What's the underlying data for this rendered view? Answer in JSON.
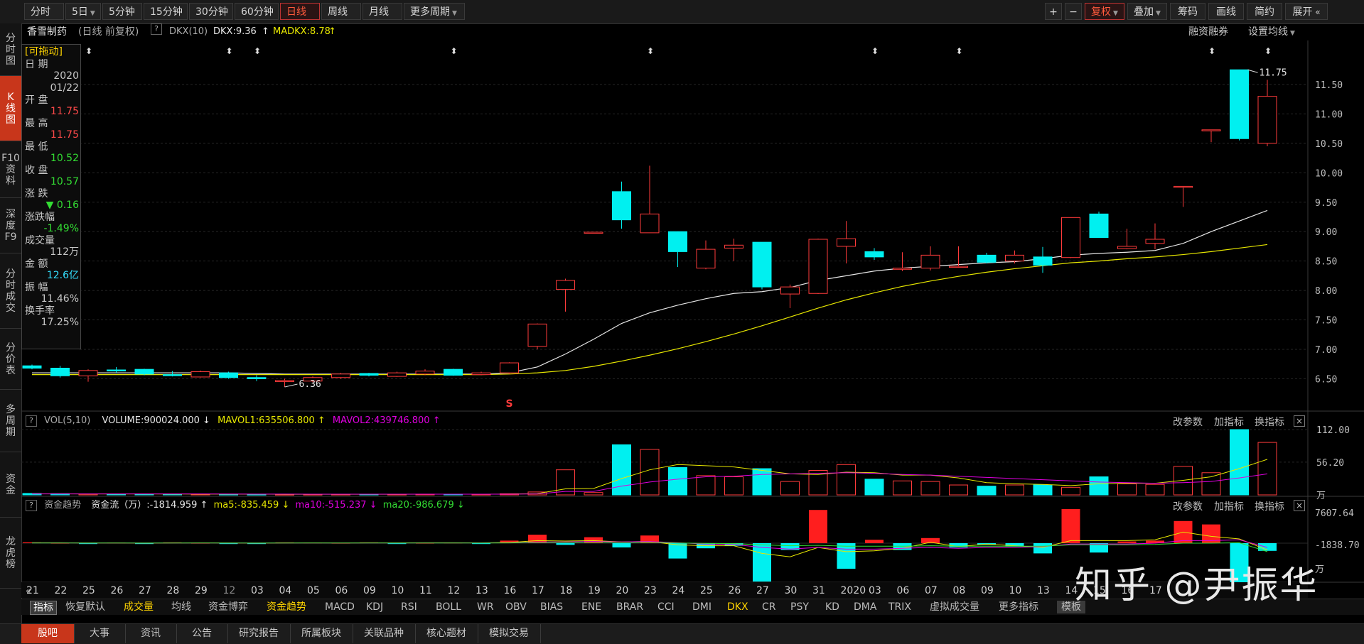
{
  "toolbar": {
    "left": [
      {
        "label": "分时",
        "dropdown": false,
        "active": false
      },
      {
        "label": "5日",
        "dropdown": true,
        "active": false
      },
      {
        "label": "5分钟",
        "dropdown": false,
        "active": false
      },
      {
        "label": "15分钟",
        "dropdown": false,
        "active": false
      },
      {
        "label": "30分钟",
        "dropdown": false,
        "active": false
      },
      {
        "label": "60分钟",
        "dropdown": false,
        "active": false
      },
      {
        "label": "日线",
        "dropdown": false,
        "active": true
      },
      {
        "label": "周线",
        "dropdown": false,
        "active": false
      },
      {
        "label": "月线",
        "dropdown": false,
        "active": false
      },
      {
        "label": "更多周期",
        "dropdown": true,
        "active": false
      }
    ],
    "right": [
      {
        "label": "+",
        "dropdown": false,
        "active": false
      },
      {
        "label": "−",
        "dropdown": false,
        "active": false
      },
      {
        "label": "复权",
        "dropdown": true,
        "active": true
      },
      {
        "label": "叠加",
        "dropdown": true,
        "active": false
      },
      {
        "label": "筹码",
        "dropdown": false,
        "active": false
      },
      {
        "label": "画线",
        "dropdown": false,
        "active": false
      },
      {
        "label": "简约",
        "dropdown": false,
        "active": false
      },
      {
        "label": "展开",
        "dropdown": false,
        "active": false
      }
    ]
  },
  "sidebar": [
    {
      "label": "分\n时\n图",
      "active": false
    },
    {
      "label": "K\n线\n图",
      "active": true
    },
    {
      "label": "F10\n资\n料",
      "active": false
    },
    {
      "label": "深\n度\nF9",
      "active": false
    },
    {
      "label": "分\n时\n成\n交",
      "active": false
    },
    {
      "label": "分\n价\n表",
      "active": false
    },
    {
      "label": "多\n周\n期",
      "active": false
    },
    {
      "label": "资\n金",
      "active": false
    },
    {
      "label": "龙\n虎\n榜",
      "active": false
    }
  ],
  "infobar": {
    "stock_name": "香雪制药",
    "period": "(日线 前复权)",
    "indicator": "DKX(10)",
    "dkx_label": "DKX:9.36",
    "madkx_label": "MADKX:8.78",
    "margin_link": "融资融券",
    "ma_settings": "设置均线"
  },
  "datebox": {
    "tag": "[可拖动]",
    "rows": [
      {
        "label": "日  期",
        "value": "2020",
        "color": "#c8c8c8"
      },
      {
        "label": "",
        "value": "01/22",
        "color": "#c8c8c8"
      },
      {
        "label": "开  盘",
        "value": "11.75",
        "color": "#ff4a4a"
      },
      {
        "label": "最  高",
        "value": "11.75",
        "color": "#ff4a4a"
      },
      {
        "label": "最  低",
        "value": "10.52",
        "color": "#33dd33"
      },
      {
        "label": "收  盘",
        "value": "10.57",
        "color": "#33dd33"
      },
      {
        "label": "涨  跌",
        "value": "▼ 0.16",
        "color": "#33dd33"
      },
      {
        "label": "涨跌幅",
        "value": "-1.49%",
        "color": "#33dd33"
      },
      {
        "label": "成交量",
        "value": "112万",
        "color": "#c8c8c8"
      },
      {
        "label": "金  额",
        "value": "12.6亿",
        "color": "#33e0ff"
      },
      {
        "label": "振  幅",
        "value": "11.46%",
        "color": "#c8c8c8"
      },
      {
        "label": "换手率",
        "value": "17.25%",
        "color": "#c8c8c8"
      }
    ]
  },
  "price_axis": [
    "11.50",
    "11.00",
    "10.50",
    "10.00",
    "9.50",
    "9.00",
    "8.50",
    "8.00",
    "7.50",
    "7.00",
    "6.50"
  ],
  "vol_axis": [
    "112.00",
    "56.20",
    "万"
  ],
  "fund_axis": [
    "7607.64",
    "-1838.70",
    "万"
  ],
  "vol_header": {
    "title": "VOL(5,10)",
    "volume": "VOLUME:900024.000",
    "mavol1": "MAVOL1:635506.800",
    "mavol2": "MAVOL2:439746.800"
  },
  "fund_header": {
    "title": "资金趋势",
    "flow": "资金流（万）:-1814.959",
    "ma5": "ma5:-835.459",
    "ma10": "ma10:-515.237",
    "ma20": "ma20:-986.679"
  },
  "panel_links": {
    "params": "改参数",
    "add": "加指标",
    "switch": "换指标",
    "close": "×"
  },
  "annotations": {
    "high_label": "11.75",
    "low_label": "6.36",
    "s_marker": "S"
  },
  "dates": [
    "21",
    "22",
    "25",
    "26",
    "27",
    "28",
    "29",
    "12",
    "03",
    "04",
    "05",
    "06",
    "09",
    "10",
    "11",
    "12",
    "13",
    "16",
    "17",
    "18",
    "19",
    "20",
    "23",
    "24",
    "25",
    "26",
    "27",
    "30",
    "31",
    "2020",
    "03",
    "06",
    "07",
    "08",
    "09",
    "10",
    "13",
    "14",
    "15",
    "16",
    "17"
  ],
  "indicator_tabs": [
    {
      "label": "指标",
      "active": true
    },
    {
      "label": "恢复默认",
      "active": false
    },
    {
      "label": "成交量",
      "active": false,
      "color": "#ffd400"
    },
    {
      "label": "均线",
      "active": false
    },
    {
      "label": "资金博弈",
      "active": false
    },
    {
      "label": "资金趋势",
      "active": false,
      "color": "#ffd400"
    },
    {
      "label": "MACD",
      "active": false
    },
    {
      "label": "KDJ",
      "active": false
    },
    {
      "label": "RSI",
      "active": false
    },
    {
      "label": "BOLL",
      "active": false
    },
    {
      "label": "WR",
      "active": false
    },
    {
      "label": "OBV",
      "active": false
    },
    {
      "label": "BIAS",
      "active": false
    },
    {
      "label": "ENE",
      "active": false
    },
    {
      "label": "BRAR",
      "active": false
    },
    {
      "label": "CCI",
      "active": false
    },
    {
      "label": "DMI",
      "active": false
    },
    {
      "label": "DKX",
      "active": false,
      "color": "#ffd400"
    },
    {
      "label": "CR",
      "active": false
    },
    {
      "label": "PSY",
      "active": false
    },
    {
      "label": "KD",
      "active": false
    },
    {
      "label": "DMA",
      "active": false
    },
    {
      "label": "TRIX",
      "active": false
    },
    {
      "label": "虚拟成交量",
      "active": false
    },
    {
      "label": "更多指标",
      "active": false
    },
    {
      "label": "模板",
      "active": false
    }
  ],
  "bottom_tabs": [
    {
      "label": "股吧",
      "active": true
    },
    {
      "label": "大事",
      "active": false
    },
    {
      "label": "资讯",
      "active": false
    },
    {
      "label": "公告",
      "active": false
    },
    {
      "label": "研究报告",
      "active": false
    },
    {
      "label": "所属板块",
      "active": false
    },
    {
      "label": "关联品种",
      "active": false
    },
    {
      "label": "核心题材",
      "active": false
    },
    {
      "label": "模拟交易",
      "active": false
    }
  ],
  "watermark": "知乎 @尹振华",
  "colors": {
    "up": "#ff3b3b",
    "down": "#00f0f0",
    "dkx": "#e6e6e6",
    "madkx": "#e6e600",
    "mavol1": "#e6e600",
    "mavol2": "#e000e0",
    "ma10": "#e000e0",
    "ma20": "#33dd33"
  },
  "chart_data": {
    "type": "candlestick",
    "price_range": [
      6.3,
      11.85
    ],
    "x_labels": [
      "21",
      "22",
      "25",
      "26",
      "27",
      "28",
      "29",
      "12",
      "03",
      "04",
      "05",
      "06",
      "09",
      "10",
      "11",
      "12",
      "13",
      "16",
      "17",
      "18",
      "19",
      "20",
      "23",
      "24",
      "25",
      "26",
      "27",
      "30",
      "31",
      "2020",
      "03",
      "06",
      "07",
      "08",
      "09",
      "10",
      "13",
      "14",
      "15",
      "16",
      "17"
    ],
    "candles": [
      {
        "o": 6.72,
        "c": 6.68,
        "h": 6.74,
        "l": 6.66
      },
      {
        "o": 6.68,
        "c": 6.55,
        "h": 6.72,
        "l": 6.52
      },
      {
        "o": 6.55,
        "c": 6.64,
        "h": 6.66,
        "l": 6.45
      },
      {
        "o": 6.65,
        "c": 6.64,
        "h": 6.7,
        "l": 6.6
      },
      {
        "o": 6.66,
        "c": 6.58,
        "h": 6.67,
        "l": 6.56
      },
      {
        "o": 6.57,
        "c": 6.56,
        "h": 6.63,
        "l": 6.54
      },
      {
        "o": 6.53,
        "c": 6.62,
        "h": 6.64,
        "l": 6.52
      },
      {
        "o": 6.6,
        "c": 6.52,
        "h": 6.62,
        "l": 6.5
      },
      {
        "o": 6.52,
        "c": 6.5,
        "h": 6.56,
        "l": 6.46
      },
      {
        "o": 6.46,
        "c": 6.47,
        "h": 6.5,
        "l": 6.36
      },
      {
        "o": 6.46,
        "c": 6.52,
        "h": 6.54,
        "l": 6.44
      },
      {
        "o": 6.52,
        "c": 6.58,
        "h": 6.6,
        "l": 6.5
      },
      {
        "o": 6.59,
        "c": 6.56,
        "h": 6.6,
        "l": 6.54
      },
      {
        "o": 6.54,
        "c": 6.6,
        "h": 6.62,
        "l": 6.53
      },
      {
        "o": 6.58,
        "c": 6.63,
        "h": 6.66,
        "l": 6.56
      },
      {
        "o": 6.66,
        "c": 6.56,
        "h": 6.67,
        "l": 6.55
      },
      {
        "o": 6.57,
        "c": 6.6,
        "h": 6.62,
        "l": 6.56
      },
      {
        "o": 6.6,
        "c": 6.77,
        "h": 6.78,
        "l": 6.58
      },
      {
        "o": 7.05,
        "c": 7.43,
        "h": 7.44,
        "l": 7.0
      },
      {
        "o": 8.02,
        "c": 8.17,
        "h": 8.2,
        "l": 7.64
      },
      {
        "o": 8.98,
        "c": 8.99,
        "h": 8.99,
        "l": 8.98
      },
      {
        "o": 9.68,
        "c": 9.2,
        "h": 9.85,
        "l": 9.05
      },
      {
        "o": 8.98,
        "c": 9.3,
        "h": 10.12,
        "l": 8.98
      },
      {
        "o": 9.0,
        "c": 8.66,
        "h": 9.0,
        "l": 8.4
      },
      {
        "o": 8.38,
        "c": 8.7,
        "h": 8.85,
        "l": 8.36
      },
      {
        "o": 8.72,
        "c": 8.77,
        "h": 8.88,
        "l": 8.5
      },
      {
        "o": 8.82,
        "c": 8.06,
        "h": 8.82,
        "l": 8.02
      },
      {
        "o": 7.94,
        "c": 8.06,
        "h": 8.1,
        "l": 7.7
      },
      {
        "o": 7.95,
        "c": 8.87,
        "h": 8.88,
        "l": 7.94
      },
      {
        "o": 8.75,
        "c": 8.88,
        "h": 9.18,
        "l": 8.46
      },
      {
        "o": 8.66,
        "c": 8.57,
        "h": 8.72,
        "l": 8.52
      },
      {
        "o": 8.36,
        "c": 8.38,
        "h": 8.65,
        "l": 8.33
      },
      {
        "o": 8.38,
        "c": 8.6,
        "h": 8.75,
        "l": 8.34
      },
      {
        "o": 8.4,
        "c": 8.41,
        "h": 8.75,
        "l": 8.4
      },
      {
        "o": 8.6,
        "c": 8.48,
        "h": 8.64,
        "l": 8.46
      },
      {
        "o": 8.5,
        "c": 8.6,
        "h": 8.68,
        "l": 8.46
      },
      {
        "o": 8.57,
        "c": 8.43,
        "h": 8.74,
        "l": 8.3
      },
      {
        "o": 8.56,
        "c": 9.24,
        "h": 9.24,
        "l": 8.55
      },
      {
        "o": 9.3,
        "c": 8.9,
        "h": 9.34,
        "l": 8.9
      },
      {
        "o": 8.71,
        "c": 8.75,
        "h": 9.05,
        "l": 8.7
      },
      {
        "o": 8.8,
        "c": 8.87,
        "h": 9.14,
        "l": 8.7
      },
      {
        "o": 9.76,
        "c": 9.77,
        "h": 9.77,
        "l": 9.42
      },
      {
        "o": 10.72,
        "c": 10.73,
        "h": 10.73,
        "l": 10.52
      },
      {
        "o": 11.75,
        "c": 10.58,
        "h": 11.75,
        "l": 10.55
      },
      {
        "o": 10.5,
        "c": 11.3,
        "h": 11.58,
        "l": 10.45
      }
    ],
    "dkx": [
      6.6,
      6.6,
      6.6,
      6.6,
      6.6,
      6.6,
      6.6,
      6.6,
      6.59,
      6.58,
      6.58,
      6.58,
      6.58,
      6.58,
      6.58,
      6.58,
      6.58,
      6.6,
      6.7,
      6.92,
      7.17,
      7.44,
      7.62,
      7.75,
      7.86,
      7.95,
      7.98,
      8.05,
      8.17,
      8.25,
      8.33,
      8.38,
      8.41,
      8.44,
      8.47,
      8.49,
      8.54,
      8.6,
      8.63,
      8.65,
      8.68,
      8.8,
      9.0,
      9.18,
      9.36
    ],
    "madkx": [
      6.57,
      6.57,
      6.57,
      6.57,
      6.57,
      6.57,
      6.57,
      6.57,
      6.57,
      6.57,
      6.57,
      6.57,
      6.57,
      6.57,
      6.57,
      6.57,
      6.57,
      6.58,
      6.6,
      6.64,
      6.71,
      6.8,
      6.9,
      7.01,
      7.13,
      7.26,
      7.4,
      7.55,
      7.7,
      7.84,
      7.96,
      8.07,
      8.16,
      8.24,
      8.31,
      8.37,
      8.42,
      8.47,
      8.5,
      8.54,
      8.57,
      8.61,
      8.66,
      8.72,
      8.78
    ],
    "volume": [
      2.5,
      2.2,
      1.5,
      1.8,
      1.4,
      1.2,
      1.3,
      1.1,
      1.0,
      0.9,
      1.0,
      1.1,
      1.2,
      1.1,
      1.3,
      1.2,
      1.0,
      2.0,
      5.0,
      43,
      4,
      86,
      78,
      47,
      33,
      31,
      45,
      23,
      42,
      52,
      27,
      24,
      23,
      17,
      15,
      17,
      17,
      13,
      31,
      19,
      18,
      49,
      38,
      112,
      90
    ],
    "mavol1": [
      1.8,
      1.8,
      1.7,
      1.7,
      1.6,
      1.5,
      1.4,
      1.3,
      1.2,
      1.1,
      1.05,
      1.05,
      1.1,
      1.1,
      1.15,
      1.2,
      1.2,
      1.35,
      2.2,
      10.4,
      11,
      28,
      43,
      52,
      50,
      48,
      42,
      36,
      35,
      39,
      38,
      34,
      34,
      29,
      21,
      19,
      18,
      16,
      19,
      20,
      20,
      25,
      31,
      45,
      61
    ],
    "mavol2": [
      1.7,
      1.7,
      1.7,
      1.7,
      1.7,
      1.6,
      1.6,
      1.5,
      1.4,
      1.3,
      1.2,
      1.2,
      1.2,
      1.2,
      1.2,
      1.15,
      1.15,
      1.2,
      1.6,
      6,
      6,
      15,
      22,
      27,
      31,
      32,
      35,
      36,
      37,
      38,
      37,
      35,
      34,
      32,
      30,
      28,
      26,
      24,
      22,
      21,
      20,
      21,
      23,
      29,
      36
    ],
    "fundflow": [
      0.1,
      0.05,
      -0.1,
      0.08,
      -0.05,
      0.1,
      0.05,
      -0.08,
      -0.05,
      0.1,
      0.08,
      0.05,
      0.1,
      -0.05,
      0.05,
      0.08,
      -0.05,
      0.3,
      1.0,
      -0.2,
      0.7,
      -0.5,
      0.9,
      -1.8,
      -0.6,
      -0.3,
      -4.5,
      -0.8,
      3.9,
      -3.0,
      0.4,
      -0.8,
      0.6,
      -0.5,
      -0.2,
      -0.4,
      -1.2,
      4.0,
      -1.1,
      0.2,
      0.3,
      2.6,
      2.2,
      -4.7,
      -0.9
    ],
    "fund_ma5": [
      0.05,
      0.05,
      0.02,
      0.02,
      0.0,
      0.02,
      0.04,
      0.02,
      0.0,
      0.02,
      0.04,
      0.02,
      0.04,
      0.04,
      0.05,
      0.05,
      0.04,
      0.08,
      0.3,
      0.25,
      0.3,
      0.15,
      0.2,
      -0.2,
      -0.3,
      -0.3,
      -1.2,
      -1.6,
      -0.5,
      -1.0,
      -0.9,
      -0.6,
      0.1,
      -0.4,
      -0.1,
      -0.3,
      -0.5,
      0.3,
      0.3,
      0.3,
      0.4,
      1.3,
      0.8,
      0.5,
      -0.8
    ],
    "fund_ma10": [
      0.03,
      0.03,
      0.02,
      0.02,
      0.02,
      0.02,
      0.02,
      0.02,
      0.02,
      0.02,
      0.02,
      0.02,
      0.02,
      0.02,
      0.03,
      0.03,
      0.03,
      0.05,
      0.15,
      0.15,
      0.2,
      0.15,
      0.2,
      0.05,
      -0.1,
      -0.15,
      -0.5,
      -0.7,
      -0.5,
      -0.7,
      -0.7,
      -0.6,
      -0.5,
      -0.6,
      -0.5,
      -0.5,
      -0.4,
      -0.1,
      -0.1,
      -0.1,
      0.0,
      0.3,
      0.3,
      0.4,
      -0.5
    ],
    "fund_ma20": [
      0.02,
      0.02,
      0.02,
      0.02,
      0.02,
      0.02,
      0.02,
      0.02,
      0.02,
      0.02,
      0.02,
      0.02,
      0.02,
      0.02,
      0.02,
      0.02,
      0.02,
      0.03,
      0.08,
      0.08,
      0.1,
      0.08,
      0.1,
      0.02,
      -0.02,
      -0.05,
      -0.2,
      -0.3,
      -0.25,
      -0.35,
      -0.35,
      -0.35,
      -0.3,
      -0.35,
      -0.35,
      -0.35,
      -0.35,
      -0.2,
      -0.2,
      -0.2,
      -0.15,
      0.0,
      0.0,
      0.05,
      -0.99
    ]
  }
}
